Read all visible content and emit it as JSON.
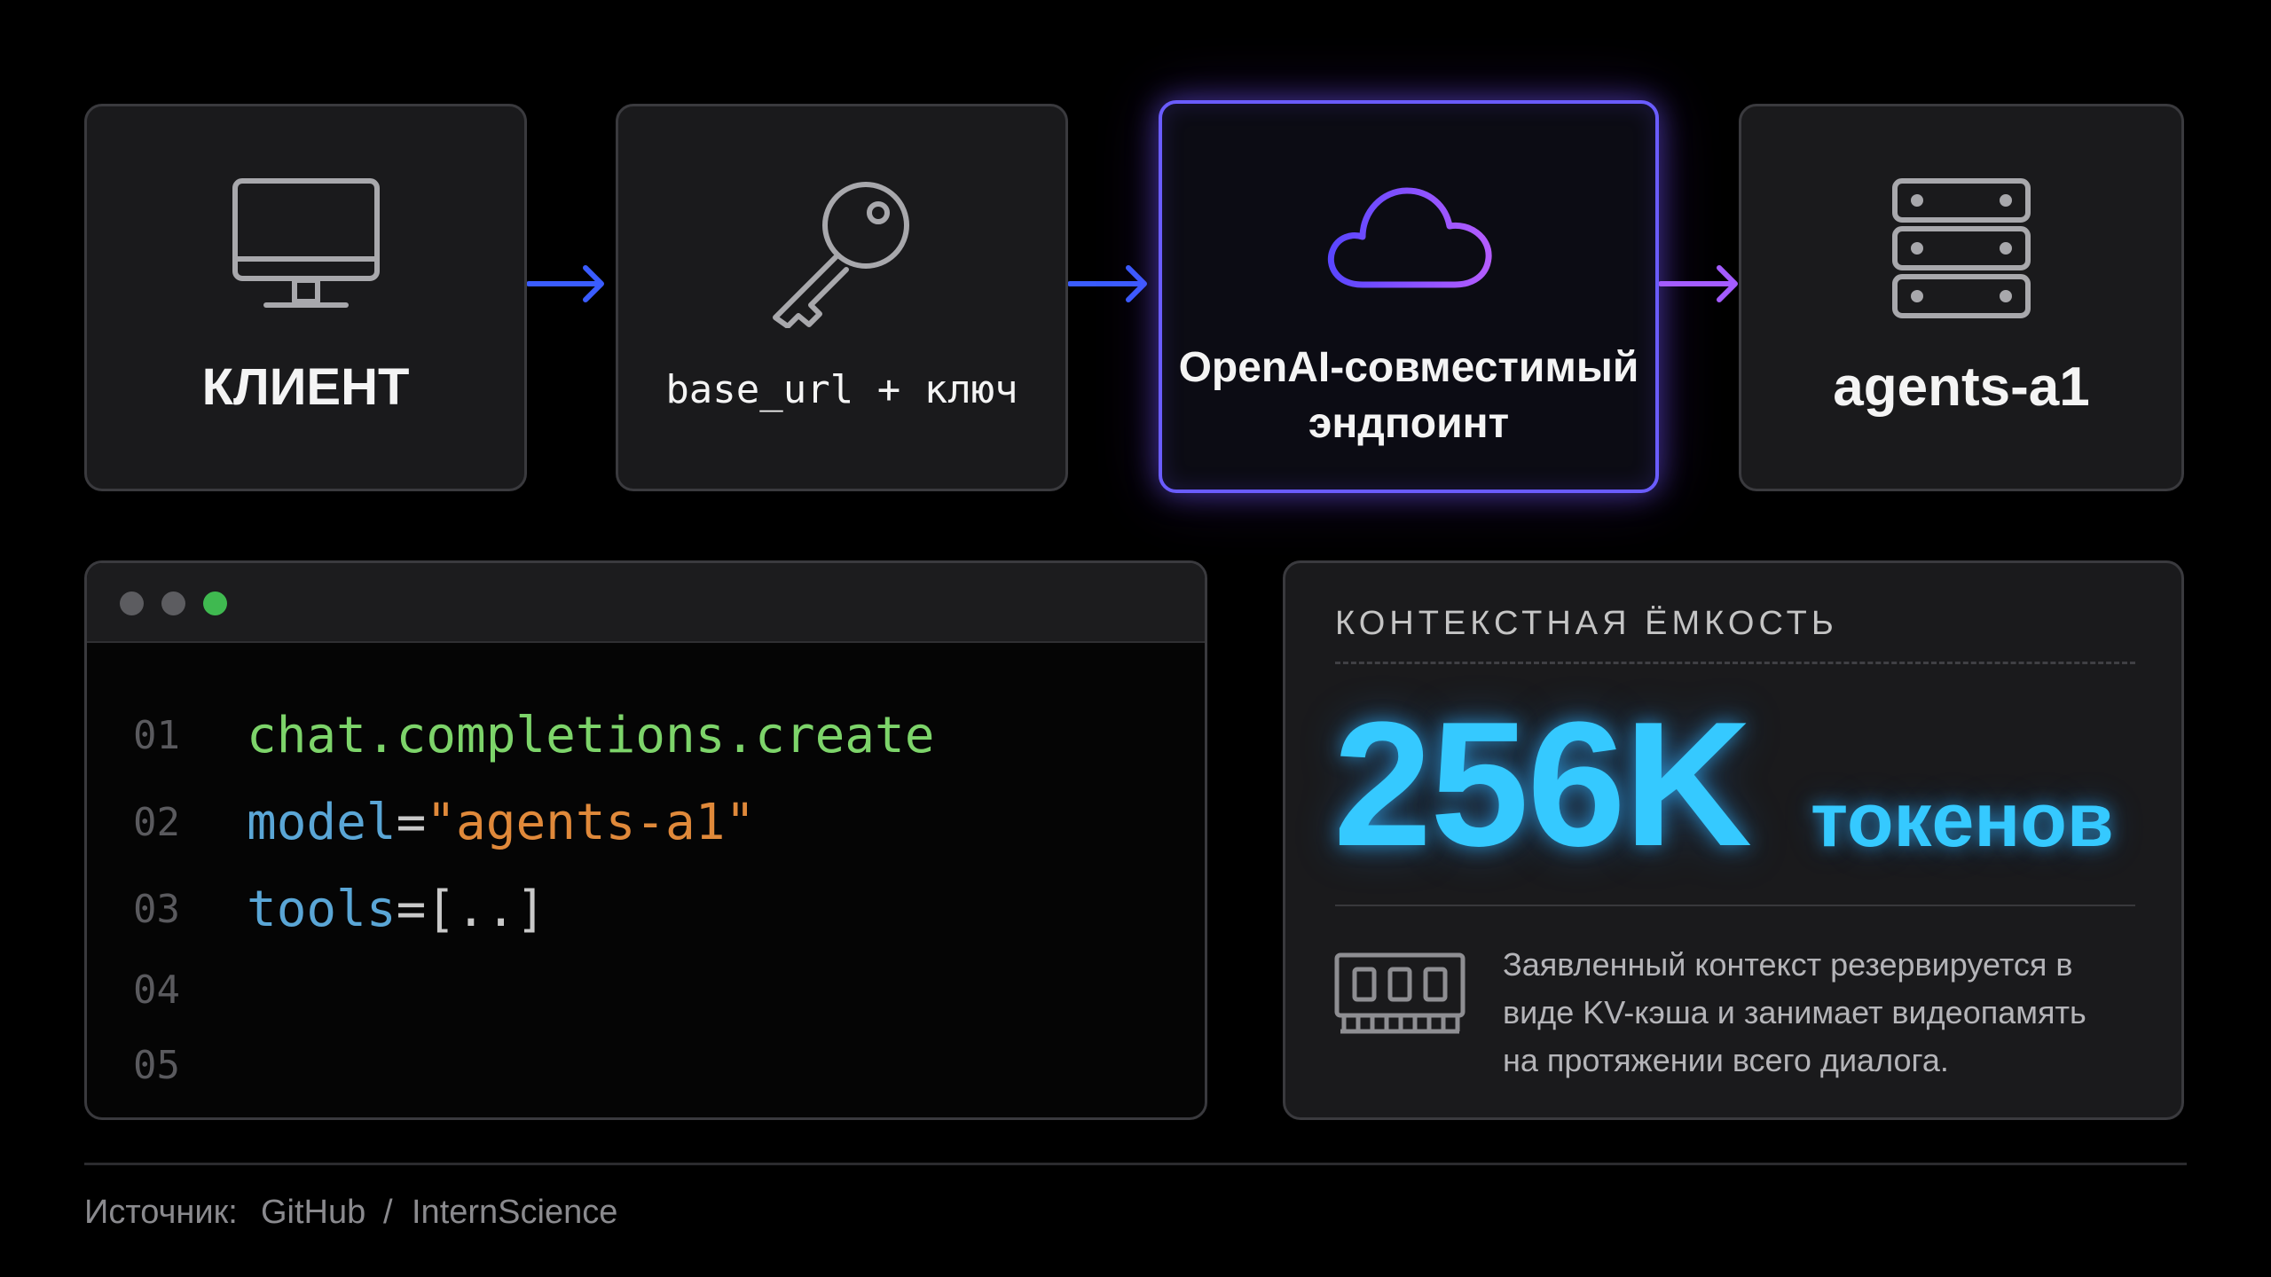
{
  "colors": {
    "background": "#000000",
    "card_bg": "#1a1a1c",
    "card_border": "#3a3a3e",
    "arrow_blue": "#3a5cff",
    "arrow_purple": "#a45cff",
    "highlight_border": "#6a5cff",
    "accent_cyan": "#35c9ff",
    "code_green": "#7dd46a",
    "code_blue": "#5aa6d6",
    "code_orange": "#e0893a"
  },
  "flow": {
    "client": {
      "icon": "monitor-icon",
      "label": "КЛИЕНТ"
    },
    "key": {
      "icon": "key-icon",
      "label": "base_url + ключ"
    },
    "endpoint": {
      "icon": "cloud-icon",
      "label_line1": "OpenAI-совместимый",
      "label_line2": "эндпоинт",
      "highlighted": true
    },
    "agents": {
      "icon": "server-icon",
      "label": "agents-a1"
    },
    "arrows": [
      "arrow-right-icon",
      "arrow-right-icon",
      "arrow-right-icon"
    ]
  },
  "code_window": {
    "window_controls": [
      "close",
      "minimize",
      "maximize"
    ],
    "window_control_colors": [
      "#5c5c60",
      "#5c5c60",
      "#3fb950"
    ],
    "lines": [
      {
        "number": "01",
        "text": "chat.completions.create"
      },
      {
        "number": "02",
        "key": "model",
        "op": "=",
        "value": "\"agents-a1\""
      },
      {
        "number": "03",
        "key": "tools",
        "op": "=",
        "value": "[..]"
      },
      {
        "number": "04"
      },
      {
        "number": "05"
      }
    ]
  },
  "context": {
    "title": "КОНТЕКСТНАЯ ЁМКОСТЬ",
    "value": "256K",
    "unit": "токенов",
    "icon": "memory-chip-icon",
    "description_lines": [
      "Заявленный контекст резервируется в",
      "виде KV-кэша и занимает видеопамять",
      "на протяжении всего диалога."
    ]
  },
  "footer": {
    "source_label": "Источник:",
    "sources": [
      "GitHub",
      "InternScience"
    ],
    "separator": "/"
  }
}
